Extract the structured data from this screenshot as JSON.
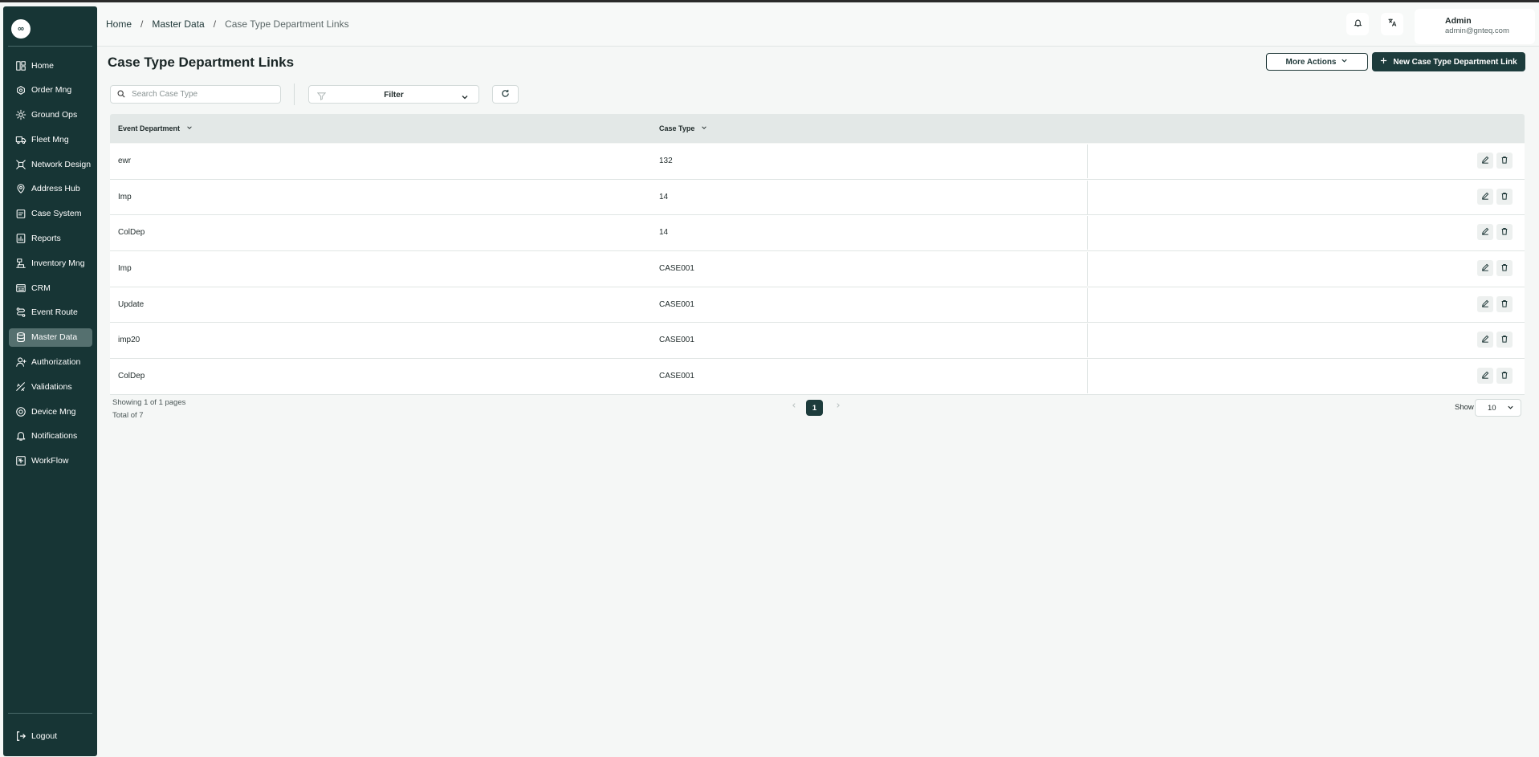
{
  "logo_text": "∞",
  "sidebar": {
    "items": [
      {
        "label": "Home",
        "icon": "home-icon",
        "active": false
      },
      {
        "label": "Order Mng",
        "icon": "order-icon",
        "active": false
      },
      {
        "label": "Ground Ops",
        "icon": "ground-ops-icon",
        "active": false
      },
      {
        "label": "Fleet Mng",
        "icon": "truck-icon",
        "active": false
      },
      {
        "label": "Network Design",
        "icon": "network-icon",
        "active": false
      },
      {
        "label": "Address Hub",
        "icon": "map-pin-icon",
        "active": false
      },
      {
        "label": "Case System",
        "icon": "case-icon",
        "active": false
      },
      {
        "label": "Reports",
        "icon": "report-icon",
        "active": false
      },
      {
        "label": "Inventory Mng",
        "icon": "inventory-icon",
        "active": false
      },
      {
        "label": "CRM",
        "icon": "crm-icon",
        "active": false
      },
      {
        "label": "Event Route",
        "icon": "route-icon",
        "active": false
      },
      {
        "label": "Master Data",
        "icon": "database-icon",
        "active": true
      },
      {
        "label": "Authorization",
        "icon": "user-icon",
        "active": false
      },
      {
        "label": "Validations",
        "icon": "validation-icon",
        "active": false
      },
      {
        "label": "Device Mng",
        "icon": "device-icon",
        "active": false
      },
      {
        "label": "Notifications",
        "icon": "bell-icon",
        "active": false
      },
      {
        "label": "WorkFlow",
        "icon": "workflow-icon",
        "active": false
      }
    ],
    "logout_label": "Logout"
  },
  "header": {
    "breadcrumb": [
      "Home",
      "Master Data",
      "Case Type Department Links"
    ],
    "breadcrumb_sep": "/",
    "user": {
      "name": "Admin",
      "email": "admin@gnteq.com"
    }
  },
  "main": {
    "title": "Case Type Department Links",
    "more_actions_label": "More Actions",
    "new_button_label": "New Case Type Department Link",
    "search_placeholder": "Search Case Type",
    "filter_label": "Filter"
  },
  "table": {
    "columns": [
      "Event Department",
      "Case Type"
    ],
    "rows": [
      {
        "department": "ewr",
        "case_type": "132"
      },
      {
        "department": "Imp",
        "case_type": "14"
      },
      {
        "department": "ColDep",
        "case_type": "14"
      },
      {
        "department": "Imp",
        "case_type": "CASE001"
      },
      {
        "department": "Update",
        "case_type": "CASE001"
      },
      {
        "department": "imp20",
        "case_type": "CASE001"
      },
      {
        "department": "ColDep",
        "case_type": "CASE001"
      }
    ]
  },
  "pagination": {
    "showing": "Showing 1 of 1 pages",
    "total": "Total of 7",
    "current_page": "1",
    "show_label": "Show",
    "page_size": "10"
  },
  "colors": {
    "sidebar_bg": "#173535",
    "sidebar_active": "#55706f",
    "primary": "#1d3c3c",
    "header_row": "#e3e8e7"
  }
}
